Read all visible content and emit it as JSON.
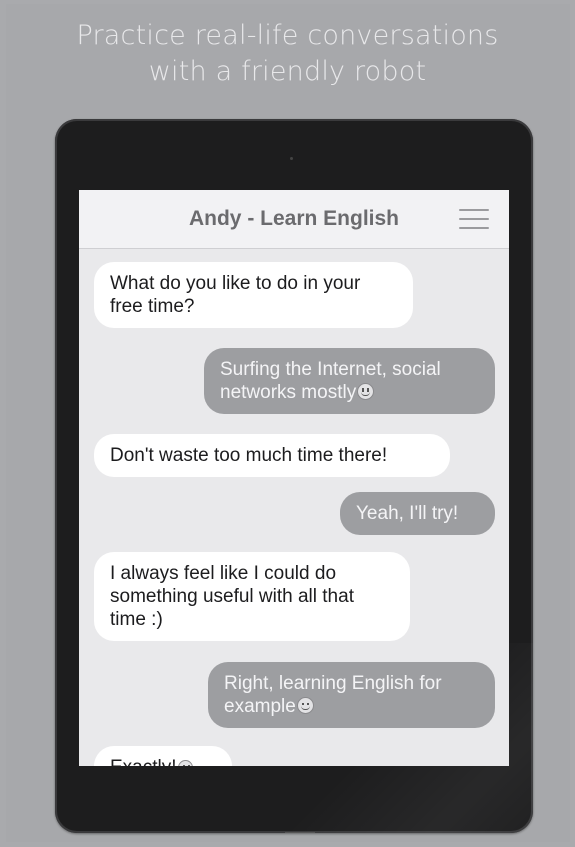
{
  "headline": {
    "line1": "Practice real-life conversations",
    "line2": "with a friendly robot"
  },
  "app": {
    "title": "Andy - Learn English",
    "menu_icon": "hamburger-menu-icon"
  },
  "messages": [
    {
      "sender": "bot",
      "line1": "What do you like to do in your",
      "line2": "free time?"
    },
    {
      "sender": "user",
      "line1": "Surfing the Internet, social",
      "line2": "networks mostly",
      "emoji": "grin-icon"
    },
    {
      "sender": "bot",
      "line1": "Don't waste too much time there!"
    },
    {
      "sender": "user",
      "line1": "Yeah, I'll try!"
    },
    {
      "sender": "bot",
      "line1": "I always feel like I could do",
      "line2": "something useful with all that",
      "line3": "time :)"
    },
    {
      "sender": "user",
      "line1": "Right, learning English for",
      "line2": "example",
      "emoji": "wink-icon"
    },
    {
      "sender": "bot",
      "line1": "Exactly!",
      "emoji": "smile-icon"
    }
  ],
  "colors": {
    "background": "#a9aaad",
    "tablet": "#1d1d1e",
    "screen": "#e9e9eb",
    "bot_bubble": "#ffffff",
    "user_bubble": "#9d9ea1"
  }
}
